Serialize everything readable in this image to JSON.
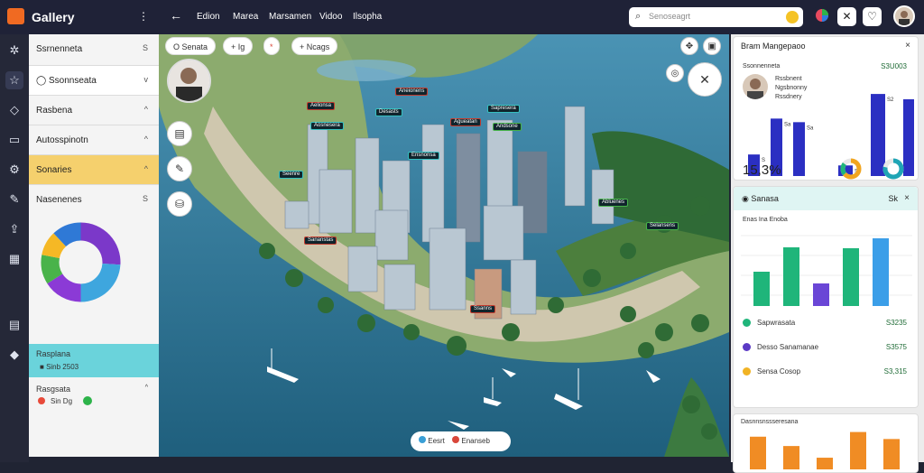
{
  "app": {
    "title": "Gallery"
  },
  "nav": {
    "items": [
      "Edion",
      "Marea",
      "Marsamen",
      "Vidoo",
      "Ilsopha"
    ]
  },
  "search": {
    "placeholder": "Senoseagrt"
  },
  "sidebar": {
    "items": [
      {
        "label": "Ssrnenneta",
        "chev": "S",
        "style": "plain"
      },
      {
        "label": "Ssonnseata",
        "chev": "v",
        "style": "selected"
      },
      {
        "label": "Rasbena",
        "chev": "^",
        "style": "plain"
      },
      {
        "label": "Autosspinotn",
        "chev": "^",
        "style": "plain"
      },
      {
        "label": "Sonaries",
        "chev": "^",
        "style": "highlight"
      },
      {
        "label": "Nasenenes",
        "chev": "S",
        "style": "plain"
      }
    ],
    "donut": {
      "slices": [
        {
          "value": 26,
          "color": "#7b38c9"
        },
        {
          "value": 24,
          "color": "#3ea6de"
        },
        {
          "value": 16,
          "color": "#8b3ad6"
        },
        {
          "value": 12,
          "color": "#49b34a"
        },
        {
          "value": 10,
          "color": "#f5b825"
        },
        {
          "value": 12,
          "color": "#2f79d6"
        }
      ]
    },
    "cyan_panel": {
      "title": "Rasplana",
      "sub": "Sinb 2503"
    },
    "bottom_panel": {
      "title": "Rasgsata",
      "legend": "Sin Dg"
    }
  },
  "map": {
    "chips": [
      {
        "label": "Senata",
        "icon": "O"
      },
      {
        "label": "Ig",
        "icon": "+"
      },
      {
        "label": "",
        "icon": "*"
      },
      {
        "label": "Ncags",
        "icon": "+"
      }
    ],
    "tags": [
      {
        "t": "Aelionsa",
        "c": "red"
      },
      {
        "t": "Aosnesera",
        "c": "teal"
      },
      {
        "t": "Desasts",
        "c": "teal"
      },
      {
        "t": "Aneionens",
        "c": "red"
      },
      {
        "t": "Agueatan",
        "c": "red"
      },
      {
        "t": "Sapresera",
        "c": "teal"
      },
      {
        "t": "Andsone",
        "c": "green"
      },
      {
        "t": "Ensnonsa",
        "c": "teal"
      },
      {
        "t": "Seenre",
        "c": "teal"
      },
      {
        "t": "Sananstas",
        "c": "red"
      },
      {
        "t": "Abluenes",
        "c": "green"
      },
      {
        "t": "Selansens",
        "c": "green"
      },
      {
        "t": "Ssanns",
        "c": "red"
      }
    ],
    "legend": {
      "a": "Eesrt",
      "b": "Enanseb"
    }
  },
  "right": {
    "top_card": {
      "title": "Bram Mangepaoo",
      "row1_left": "Ssonnenneta",
      "row1_right": "S3U003",
      "person_line1": "Rssbnent",
      "person_line2": "Ngsbnonny",
      "person_line3": "Rssdnery",
      "percent": "15,3%",
      "bars_a": [
        12,
        32,
        30
      ],
      "bars_b": [
        8,
        62,
        58
      ],
      "bars_a_labels": [
        "S",
        "Sa",
        "Sa"
      ],
      "bars_b_labels": [
        "S",
        "S2",
        "S2"
      ]
    },
    "mid_card": {
      "title": "Sanasa",
      "right_label": "Sk",
      "subtitle": "Enas Ina Enoba",
      "bars": [
        {
          "v": 38,
          "color": "#1fb57a"
        },
        {
          "v": 65,
          "color": "#1fb57a"
        },
        {
          "v": 25,
          "color": "#6a46d6"
        },
        {
          "v": 64,
          "color": "#1fb57a"
        },
        {
          "v": 75,
          "color": "#3b9ee8"
        }
      ],
      "legend": [
        {
          "label": "Sapwrasata",
          "value": "S3235",
          "color": "#1fb57a"
        },
        {
          "label": "Desso Sanamanae",
          "value": "S3575",
          "color": "#5b3ac5"
        },
        {
          "label": "Sensa Cosop",
          "value": "S3,315",
          "color": "#f1b324"
        }
      ]
    },
    "bottom_card": {
      "title": "Dasnnsnssseresana",
      "bars": [
        28,
        20,
        10,
        32,
        26
      ]
    }
  }
}
